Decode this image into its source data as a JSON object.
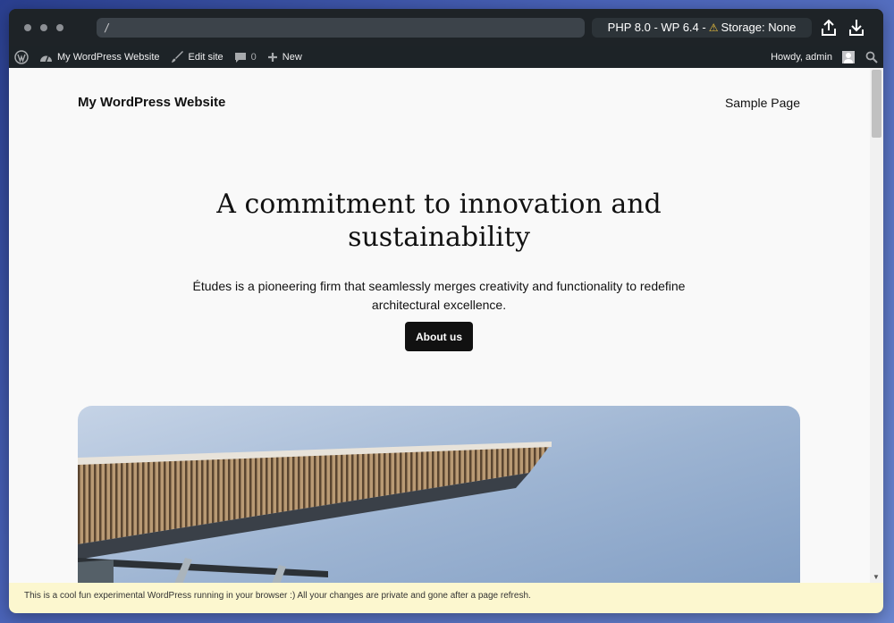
{
  "browser": {
    "url": "/",
    "env_info": "PHP 8.0 - WP 6.4 -",
    "storage_label": "Storage: None"
  },
  "admin_bar": {
    "site_name": "My WordPress Website",
    "edit_site": "Edit site",
    "comment_count": "0",
    "new_label": "New",
    "greeting": "Howdy, admin"
  },
  "site": {
    "title": "My WordPress Website",
    "nav": [
      "Sample Page"
    ]
  },
  "hero": {
    "heading": "A commitment to innovation and sustainability",
    "text": "Études is a pioneering firm that seamlessly merges creativity and functionality to redefine architectural excellence.",
    "button_label": "About us"
  },
  "notice": "This is a cool fun experimental WordPress running in your browser :) All your changes are private and gone after a page refresh.",
  "colors": {
    "admin_bar": "#1d2327",
    "page_bg": "#f9f9f9",
    "button_bg": "#111111",
    "notice_bg": "#fcf7cf",
    "warning": "#f0c33c"
  }
}
